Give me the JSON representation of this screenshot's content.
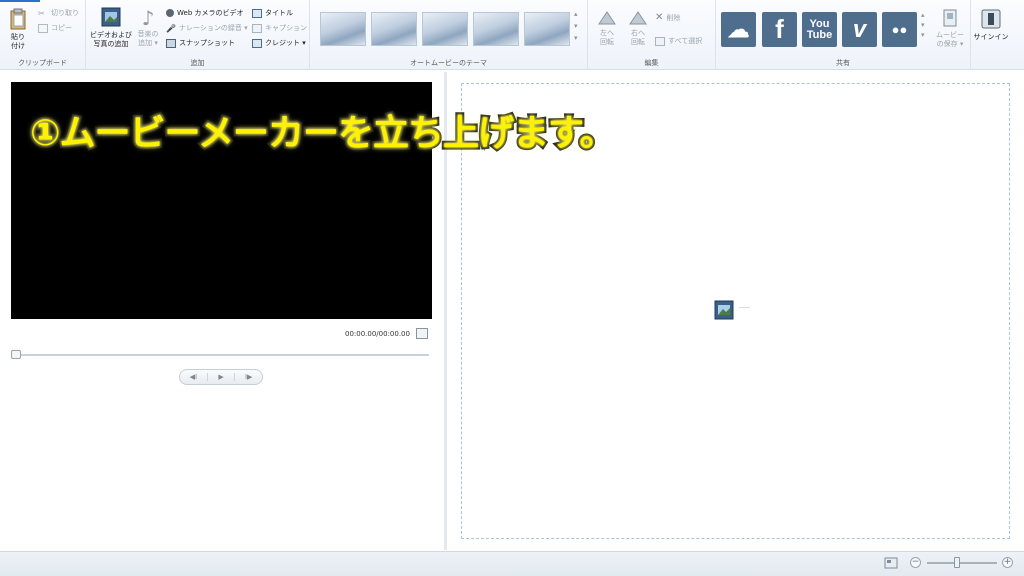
{
  "ribbon": {
    "clipboard": {
      "paste_label_1": "貼り",
      "paste_label_2": "付け",
      "cut_label": "切り取り",
      "copy_label": "コピー",
      "group_label": "クリップボード"
    },
    "add": {
      "add_videos_label_1": "ビデオおよび",
      "add_videos_label_2": "写真の追加",
      "add_music_label_1": "音楽の",
      "add_music_label_2": "追加 ▾",
      "webcam_label": "Web カメラのビデオ",
      "narration_label": "ナレーションの録音 ▾",
      "snapshot_label": "スナップショット",
      "title_label": "タイトル",
      "caption_label": "キャプション",
      "credits_label": "クレジット ▾",
      "group_label": "追加"
    },
    "automovie": {
      "group_label": "オートムービーのテーマ",
      "scroll_up": "▴",
      "scroll_down": "▾",
      "more": "▾"
    },
    "edit": {
      "rotate_left_1": "左へ",
      "rotate_left_2": "回転",
      "rotate_right_1": "右へ",
      "rotate_right_2": "回転",
      "delete_label": "削除",
      "select_all_label": "すべて選択",
      "group_label": "編集"
    },
    "share": {
      "onedrive": "☁",
      "facebook": "f",
      "youtube_1": "You",
      "youtube_2": "Tube",
      "vimeo": "v",
      "flickr": "●●",
      "save_movie_1": "ムービー",
      "save_movie_2": "の保存 ▾",
      "group_label": "共有"
    },
    "signin_label": "サインイン"
  },
  "preview": {
    "timecode": "00:00.00/00:00.00",
    "prev_frame": "◀I",
    "play": "▶",
    "next_frame": "I▶"
  },
  "overlay": {
    "caption": "①ムービーメーカーを立ち上げます。"
  },
  "statusbar": {
    "zoom_out": "−",
    "zoom_in": "+"
  }
}
